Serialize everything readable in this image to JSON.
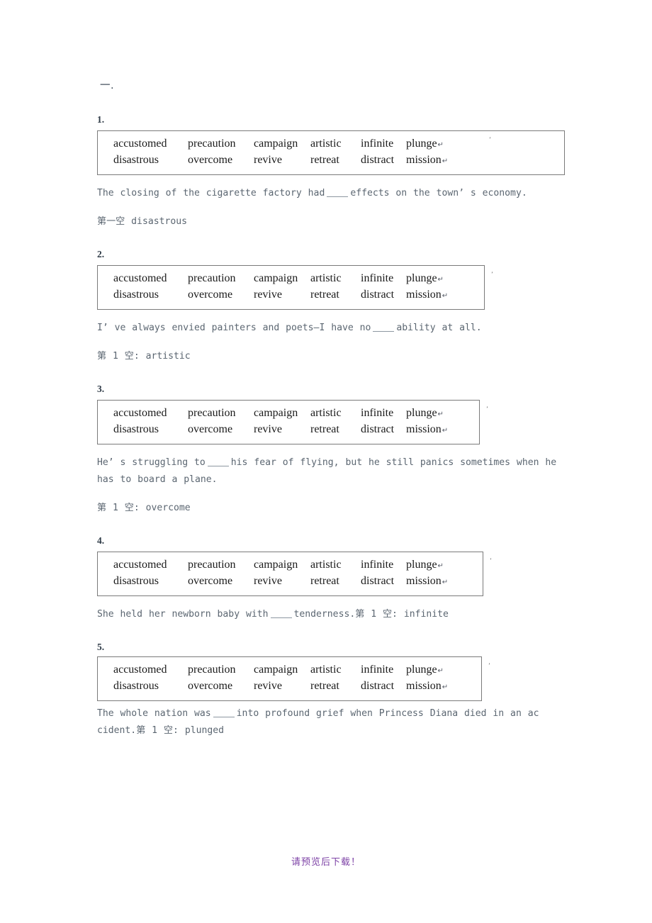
{
  "document": {
    "section_heading": "一.",
    "footer_note": "请预览后下载！",
    "footer_color": "#7d42a6",
    "text_color": "#5b6671",
    "box_border_color": "#7a7a7a",
    "blank_marker": "____",
    "pilcrow_glyph": "↵",
    "outer_mark_glyph": "’"
  },
  "word_bank": {
    "row1": [
      "accustomed",
      "precaution",
      "campaign",
      "artistic",
      "infinite",
      "plunge"
    ],
    "row2": [
      "disastrous",
      "overcome",
      "revive",
      "retreat",
      "distract",
      "mission"
    ]
  },
  "items": [
    {
      "number": "1.",
      "sentence_before": "The closing of the cigarette factory had",
      "sentence_after": "effects on the town’ s economy.",
      "answer_label": "第一空",
      "answer_value": "disastrous",
      "answer_separator": " ",
      "answer_inline": false
    },
    {
      "number": "2.",
      "sentence_before": "I’ ve always envied painters and poets—I have no",
      "sentence_after": "ability at all.",
      "answer_label": "第 1 空:",
      "answer_value": "artistic",
      "answer_separator": " ",
      "answer_inline": false
    },
    {
      "number": "3.",
      "sentence_before": "He’ s struggling to",
      "sentence_after": "his fear of flying, but he still panics sometimes when he has to board a plane.",
      "answer_label": "第 1 空:",
      "answer_value": "overcome",
      "answer_separator": " ",
      "answer_inline": false
    },
    {
      "number": "4.",
      "sentence_before": "She held her newborn baby with",
      "sentence_after": "tenderness.",
      "answer_label": "第 1 空:",
      "answer_value": "infinite",
      "answer_separator": " ",
      "answer_inline": true
    },
    {
      "number": "5.",
      "sentence_before": "The whole nation was",
      "sentence_after": "into profound grief when Princess Diana died in an ac cident.",
      "answer_label": "第 1 空:",
      "answer_value": "plunged",
      "answer_separator": " ",
      "answer_inline": true
    }
  ]
}
